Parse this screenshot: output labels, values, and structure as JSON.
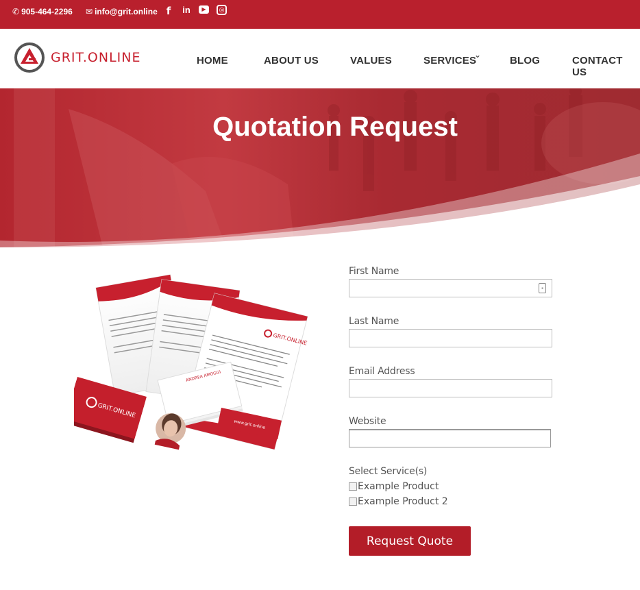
{
  "topbar": {
    "phone": "905-464-2296",
    "email": "info@grit.online",
    "social": [
      "facebook-icon",
      "linkedin-icon",
      "youtube-icon",
      "instagram-icon"
    ],
    "social_glyphs": {
      "facebook": "f",
      "linkedin": "in",
      "youtube": "▶",
      "instagram": "◎"
    }
  },
  "header": {
    "logo_text": "GRIT.ONLINE",
    "nav": [
      "HOME",
      "ABOUT US",
      "VALUES",
      "SERVICES",
      "BLOG",
      "CONTACT US"
    ]
  },
  "hero": {
    "title": "Quotation Request"
  },
  "illustration": {
    "card_logo": "GRIT.ONLINE",
    "card_name": "ANDREA AMOGGI",
    "card_url": "www.grit.online"
  },
  "form": {
    "first_name_label": "First Name",
    "last_name_label": "Last Name",
    "email_label": "Email Address",
    "website_label": "Website",
    "services_label": "Select Service(s)",
    "service_1": "Example Product",
    "service_2": "Example Product 2",
    "submit_label": "Request Quote"
  },
  "colors": {
    "brand_red": "#b9202d",
    "button_red": "#b31d28",
    "nav_text": "#333333"
  }
}
